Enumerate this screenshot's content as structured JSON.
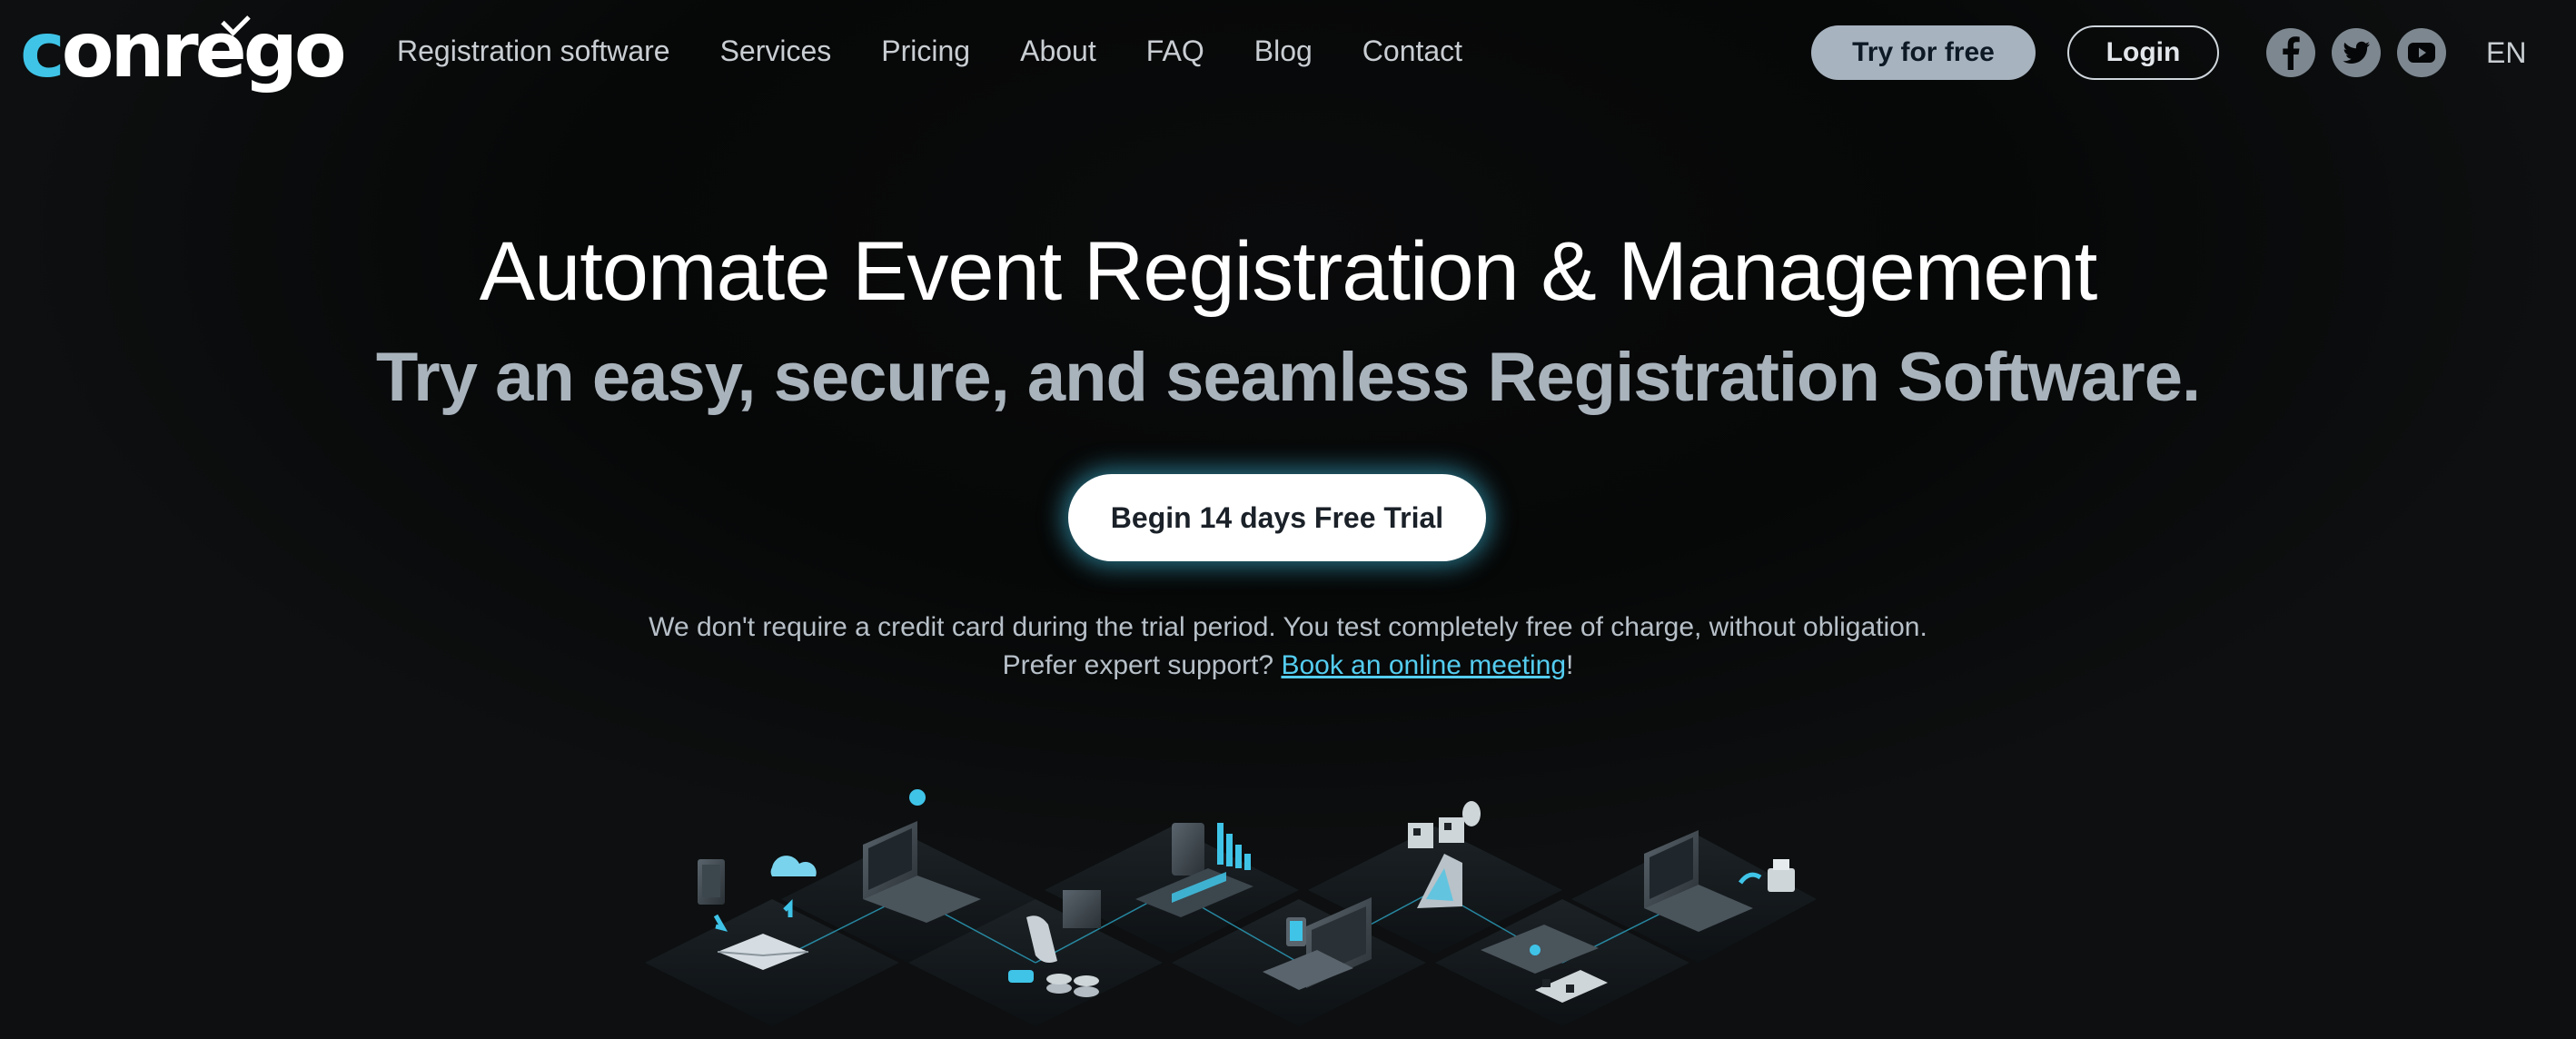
{
  "brand": {
    "logo_first": "c",
    "logo_rest": "onrego",
    "accent": "#3fc4e8"
  },
  "nav": {
    "items": [
      {
        "label": "Registration software"
      },
      {
        "label": "Services"
      },
      {
        "label": "Pricing"
      },
      {
        "label": "About"
      },
      {
        "label": "FAQ"
      },
      {
        "label": "Blog"
      },
      {
        "label": "Contact"
      }
    ]
  },
  "header": {
    "try_label": "Try for free",
    "login_label": "Login",
    "language": "EN",
    "social": [
      "facebook-icon",
      "twitter-icon",
      "youtube-icon"
    ]
  },
  "hero": {
    "title": "Automate Event Registration & Management",
    "subtitle": "Try an easy, secure, and seamless Registration Software.",
    "cta_label": "Begin 14 days Free Trial",
    "note_line1": "We don't require a credit card during the trial period. You test completely free of charge, without obligation.",
    "note_line2_prefix": "Prefer expert support? ",
    "note_link": "Book an online meeting",
    "note_line2_suffix": "!"
  },
  "colors": {
    "background": "#050607",
    "nav_text": "#c9ced3",
    "try_button": "#a7b3bf",
    "link": "#54cdf0"
  }
}
